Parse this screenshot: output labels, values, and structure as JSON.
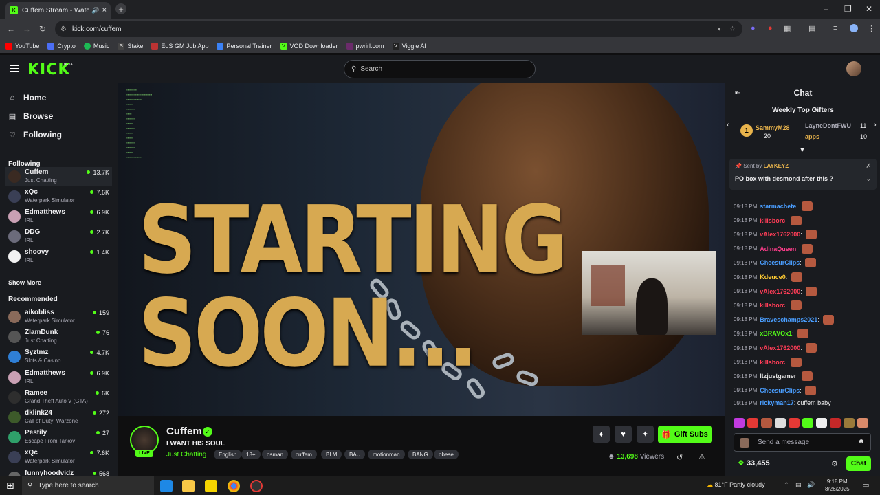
{
  "browser": {
    "tab_title": "Cuffem Stream - Watch Live",
    "tab_close": "×",
    "new_tab": "+",
    "url": "kick.com/cuffem",
    "bookmarks": [
      {
        "label": "YouTube",
        "color": "#ff0000"
      },
      {
        "label": "Crypto",
        "color": "#4c6ef5"
      },
      {
        "label": "Music",
        "color": "#1db954"
      },
      {
        "label": "Stake",
        "color": "#444"
      },
      {
        "label": "EoS GM Job App",
        "color": "#b33"
      },
      {
        "label": "Personal Trainer",
        "color": "#3b82f6"
      },
      {
        "label": "VOD Downloader",
        "color": "#53fc18"
      },
      {
        "label": "pwrirl.com",
        "color": "#6b2b6b"
      },
      {
        "label": "Viggle AI",
        "color": "#222"
      }
    ]
  },
  "kick": {
    "logo": "KICK",
    "beta": "BETA",
    "search_placeholder": "Search"
  },
  "sidebar": {
    "nav": [
      {
        "label": "Home",
        "icon": "home-icon"
      },
      {
        "label": "Browse",
        "icon": "browse-icon"
      },
      {
        "label": "Following",
        "icon": "heart-icon"
      }
    ],
    "following_header": "Following",
    "following": [
      {
        "name": "Cuffem",
        "category": "Just Chatting",
        "viewers": "13.7K",
        "color": "#3a2a22"
      },
      {
        "name": "xQc",
        "category": "Waterpark Simulator",
        "viewers": "7.6K",
        "color": "#3a3f55"
      },
      {
        "name": "Edmatthews",
        "category": "IRL",
        "viewers": "6.9K",
        "color": "#c9a0b4"
      },
      {
        "name": "DDG",
        "category": "IRL",
        "viewers": "2.7K",
        "color": "#6b6b7b"
      },
      {
        "name": "shoovy",
        "category": "IRL",
        "viewers": "1.4K",
        "color": "#f2f2f2"
      }
    ],
    "show_more": "Show More",
    "recommended_header": "Recommended",
    "recommended": [
      {
        "name": "aikobliss",
        "category": "Waterpark Simulator",
        "viewers": "159",
        "color": "#8a6a5a"
      },
      {
        "name": "ZlamDunk",
        "category": "Just Chatting",
        "viewers": "76",
        "color": "#555"
      },
      {
        "name": "Syztmz",
        "category": "Slots & Casino",
        "viewers": "4.7K",
        "color": "#2f7fd6"
      },
      {
        "name": "Edmatthews",
        "category": "IRL",
        "viewers": "6.9K",
        "color": "#c9a0b4"
      },
      {
        "name": "Ramee",
        "category": "Grand Theft Auto V (GTA)",
        "viewers": "6K",
        "color": "#2e2e2e"
      },
      {
        "name": "dklink24",
        "category": "Call of Duty: Warzone",
        "viewers": "272",
        "color": "#3d5a2a"
      },
      {
        "name": "Pestily",
        "category": "Escape From Tarkov",
        "viewers": "27",
        "color": "#2fa06a"
      },
      {
        "name": "xQc",
        "category": "Waterpark Simulator",
        "viewers": "7.6K",
        "color": "#3a3f55"
      },
      {
        "name": "funnyhoodvidz",
        "category": "",
        "viewers": "568",
        "color": "#666"
      }
    ]
  },
  "video": {
    "overlay_text": "STARTING\nSOON..."
  },
  "stream": {
    "channel": "Cuffem",
    "live": "LIVE",
    "title": "I WANT HIS SOUL",
    "category": "Just Chatting",
    "tags": [
      "English",
      "18+",
      "osman",
      "cuffem",
      "BLM",
      "BAU",
      "motionman",
      "BANG",
      "obese"
    ],
    "gift_subs": "Gift Subs",
    "viewers": "13,698",
    "viewers_label": "Viewers"
  },
  "chat": {
    "title": "Chat",
    "gifters_title": "Weekly Top Gifters",
    "gifters": [
      {
        "rank": "1",
        "name": "SammyM28",
        "count": "20"
      },
      {
        "name": "LayneDontFWU",
        "count": "11"
      },
      {
        "name": "apps",
        "count": "10"
      }
    ],
    "pinned_sent_by": "Sent by",
    "pinned_user": "LAYKEYZ",
    "pinned_message": "PO box with desmond after this ?",
    "messages": [
      {
        "time": "09:18 PM",
        "user": "starmachete",
        "color": "#4a9eff",
        "text": ""
      },
      {
        "time": "09:18 PM",
        "user": "killsborc",
        "color": "#ff3d57",
        "text": ""
      },
      {
        "time": "09:18 PM",
        "user": "vAlex1762000",
        "color": "#ff3d57",
        "text": ""
      },
      {
        "time": "09:18 PM",
        "user": "AdinaQueen",
        "color": "#ff3d8b",
        "text": ""
      },
      {
        "time": "09:18 PM",
        "user": "CheesurClips",
        "color": "#4a9eff",
        "text": ""
      },
      {
        "time": "09:18 PM",
        "user": "Kdeuce0",
        "color": "#ffcc33",
        "text": ""
      },
      {
        "time": "09:18 PM",
        "user": "vAlex1762000",
        "color": "#ff3d57",
        "text": ""
      },
      {
        "time": "09:18 PM",
        "user": "killsborc",
        "color": "#ff3d57",
        "text": ""
      },
      {
        "time": "09:18 PM",
        "user": "Braveschamps2021",
        "color": "#4a9eff",
        "text": ""
      },
      {
        "time": "09:18 PM",
        "user": "xBRAVOx1",
        "color": "#53fc18",
        "text": ""
      },
      {
        "time": "09:18 PM",
        "user": "vAlex1762000",
        "color": "#ff3d57",
        "text": ""
      },
      {
        "time": "09:18 PM",
        "user": "killsborc",
        "color": "#ff3d57",
        "text": ""
      },
      {
        "time": "09:18 PM",
        "user": "Itzjustgamer",
        "color": "#e0e0e0",
        "text": ""
      },
      {
        "time": "09:18 PM",
        "user": "CheesurClips",
        "color": "#4a9eff",
        "text": ""
      },
      {
        "time": "09:18 PM",
        "user": "rickyman17",
        "color": "#4a9eff",
        "text": "cuffem baby"
      }
    ],
    "input_placeholder": "Send a message",
    "points": "33,455",
    "chat_button": "Chat"
  },
  "taskbar": {
    "search_placeholder": "Type here to search",
    "weather": "81°F  Partly cloudy",
    "time": "9:18 PM",
    "date": "8/26/2025"
  }
}
